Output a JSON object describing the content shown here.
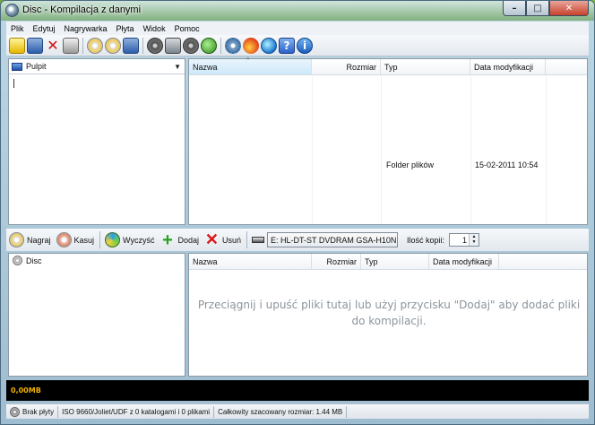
{
  "window": {
    "title": "Disc - Kompilacja z danymi",
    "caption_buttons": {
      "minimize": "–",
      "maximize": "□",
      "close": "✕"
    }
  },
  "menu": [
    "Plik",
    "Edytuj",
    "Nagrywarka",
    "Płyta",
    "Widok",
    "Pomoc"
  ],
  "toolbar": {
    "icons": [
      "new-icon",
      "save-icon",
      "delete-icon",
      "print-icon",
      "burn-disc-icon",
      "copy-disc-icon",
      "save-image-icon",
      "open-image-icon",
      "drive-icon",
      "back-icon",
      "forward-icon",
      "settings-icon",
      "burn-flame-icon",
      "globe-icon",
      "help-icon",
      "info-icon"
    ],
    "help_glyph": "?",
    "info_glyph": "i",
    "delete_glyph": "✕"
  },
  "browser": {
    "location": "Pulpit",
    "location_arrow": "▼",
    "columns": [
      "Nazwa",
      "Rozmiar",
      "Typ",
      "Data modyfikacji"
    ],
    "rows": [
      {
        "name": "",
        "size": "",
        "type": "Folder plików",
        "modified": "15-02-2011 10:54"
      }
    ]
  },
  "actions": {
    "burn_label": "Nagraj",
    "erase_label": "Kasuj",
    "clear_label": "Wyczyść",
    "add_label": "Dodaj",
    "add_glyph": "+",
    "remove_label": "Usuń",
    "remove_glyph": "✕",
    "drive_value": "E: HL-DT-ST DVDRAM GSA-H10N",
    "drive_arrow": "▼",
    "copies_label": "Ilość kopii:",
    "copies_value": "1",
    "spin_up": "▲",
    "spin_down": "▼"
  },
  "compilation": {
    "tree_root": "Disc",
    "columns": [
      "Nazwa",
      "Rozmiar",
      "Typ",
      "Data modyfikacji"
    ],
    "drop_hint": "Przeciągnij i upuść pliki tutaj lub użyj przycisku \"Dodaj\" aby dodać pliki do kompilacji."
  },
  "capacity": {
    "used_label": "0,00MB",
    "used_fraction": 0
  },
  "status": {
    "disc": "Brak płyty",
    "filesystem": "ISO 9660/Joliet/UDF z 0 katalogami i 0 plikami",
    "estimated_size": "Całkowity szacowany rozmiar: 1.44 MB"
  }
}
